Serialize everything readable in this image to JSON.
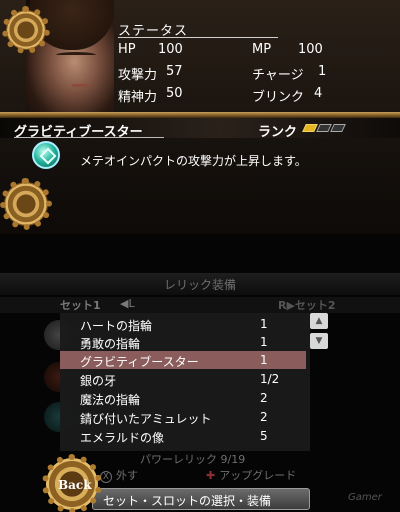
{
  "status": {
    "title": "ステータス",
    "stats": [
      {
        "label": "HP",
        "value": "100"
      },
      {
        "label": "攻撃力",
        "value": "57"
      },
      {
        "label": "精神力",
        "value": "50"
      },
      {
        "label": "MP",
        "value": "100"
      },
      {
        "label": "チャージ",
        "value": "1"
      },
      {
        "label": "ブリンク",
        "value": "4"
      }
    ]
  },
  "skill": {
    "name": "グラビティブースター",
    "rank_label": "ランク",
    "rank_level": 1,
    "rank_max": 3,
    "description": "メテオインパクトの攻撃力が上昇します。",
    "icon": "gem-icon"
  },
  "relic_menu": {
    "title": "レリック装備",
    "set1_label": "セット1",
    "set1_key": "◀L",
    "set2_label": "R▶セット2",
    "items": [
      {
        "name": "ハートの指輪",
        "count": "1"
      },
      {
        "name": "勇敢の指輪",
        "count": "1"
      },
      {
        "name": "グラビティブースター",
        "count": "1"
      },
      {
        "name": "銀の牙",
        "count": "1/2"
      },
      {
        "name": "魔法の指輪",
        "count": "2"
      },
      {
        "name": "錆び付いたアミュレット",
        "count": "2"
      },
      {
        "name": "エメラルドの像",
        "count": "5"
      }
    ],
    "selected_index": 2,
    "power_relic": "パワーレリック 9/19",
    "hint_x_key": "X",
    "hint_x": "外す",
    "hint_dpad_key": "✚",
    "hint_dpad": "アップグレード",
    "scroll_up": "▲",
    "scroll_down": "▼"
  },
  "footer": {
    "back_label": "Back",
    "action_label": "セット・スロットの選択・装備",
    "watermark": "Gamer"
  },
  "colors": {
    "selected_row": "#8a5c5c",
    "rank_on": "#e6b622",
    "brass": "#c9a15a"
  }
}
